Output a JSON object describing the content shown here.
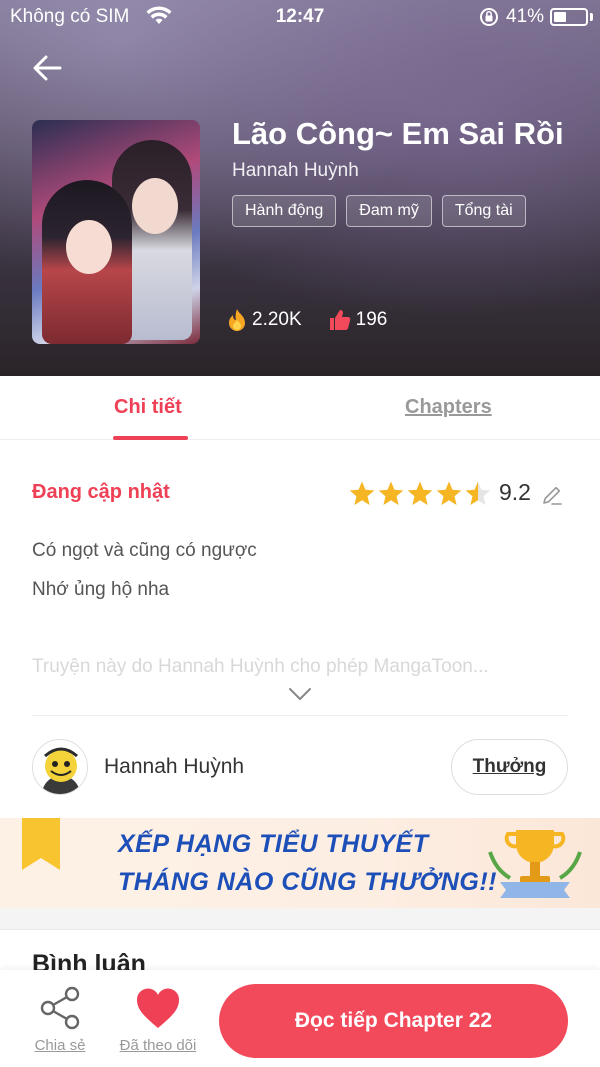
{
  "status_bar": {
    "carrier": "Không có SIM",
    "time": "12:47",
    "battery": "41%",
    "battery_level": 0.41
  },
  "header": {
    "title": "Lão Công~ Em Sai Rồi",
    "author": "Hannah Huỳnh",
    "tags": [
      "Hành động",
      "Đam mỹ",
      "Tổng tài"
    ],
    "views": "2.20K",
    "likes": "196",
    "icons": {
      "back": "arrow-left-icon",
      "views": "fire-icon",
      "likes": "thumbs-up-icon"
    }
  },
  "tabs": [
    {
      "label": "Chi tiết",
      "active": true
    },
    {
      "label": "Chapters",
      "active": false
    }
  ],
  "detail": {
    "status": "Đang cập nhật",
    "rating": "9.2",
    "stars_filled": 4.5,
    "stars_total": 5,
    "description": [
      "Có ngọt và cũng có ngược",
      "Nhớ ủng hộ nha"
    ],
    "description_truncated": "Truyện này do Hannah Huỳnh cho phép MangaToon...",
    "author_name": "Hannah Huỳnh",
    "reward_label": "Thưởng"
  },
  "banner": {
    "line1": "XẾP HẠNG TIỂU THUYẾT",
    "line2": "THÁNG NÀO CŨNG THƯỞNG!!"
  },
  "comments": {
    "title": "Bình luận"
  },
  "bottom_bar": {
    "share_label": "Chia sẻ",
    "follow_label": "Đã theo dõi",
    "read_label": "Đọc tiếp Chapter 22"
  },
  "colors": {
    "accent": "#ef4156",
    "read_button": "#f24a5b",
    "star": "#f6b623",
    "banner_text": "#1d4fb8"
  }
}
